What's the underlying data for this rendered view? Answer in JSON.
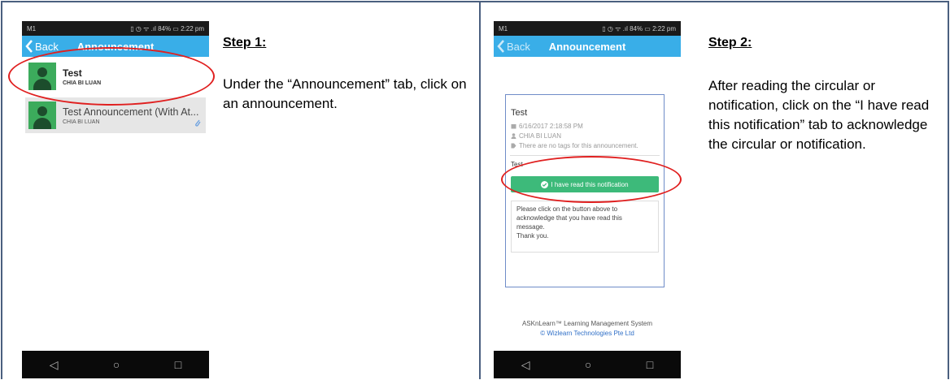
{
  "status_bar": {
    "carrier": "M1",
    "right": "▯ ◷ ᯤ .ıl 84% ▭ 2:22 pm"
  },
  "app_bar": {
    "back_label": "Back",
    "title": "Announcement"
  },
  "list": {
    "items": [
      {
        "title": "Test",
        "author": "CHIA BI LUAN"
      },
      {
        "title": "Test Announcement (With At...",
        "author": "CHIA BI LUAN"
      }
    ]
  },
  "detail": {
    "title": "Test",
    "date": "6/16/2017 2:18:58 PM",
    "author": "CHIA BI LUAN",
    "tags": "There are no tags for this announcement.",
    "body": "Test",
    "button_label": "I have read this notification",
    "note": [
      "Please click on the button above to",
      "acknowledge that you have read this",
      "message.",
      "Thank you."
    ],
    "footer_line1": "ASKnLearn™ Learning Management System",
    "footer_line2": "© Wizlearn Technologies Pte Ltd"
  },
  "steps": [
    {
      "heading": "Step 1:",
      "text": "Under the “Announcement” tab, click on an announcement."
    },
    {
      "heading": "Step 2:",
      "text": "After reading the circular or notification, click on the “I have read this notification” tab to acknowledge the circular or notification."
    }
  ],
  "nav": {
    "back": "◁",
    "home": "○",
    "recent": "□"
  },
  "colors": {
    "app_bar": "#39aee8",
    "ack_button": "#3dba7a",
    "highlight_ring": "#e02020",
    "avatar": "#3cab5c",
    "frame_border": "#4a5f7f"
  }
}
